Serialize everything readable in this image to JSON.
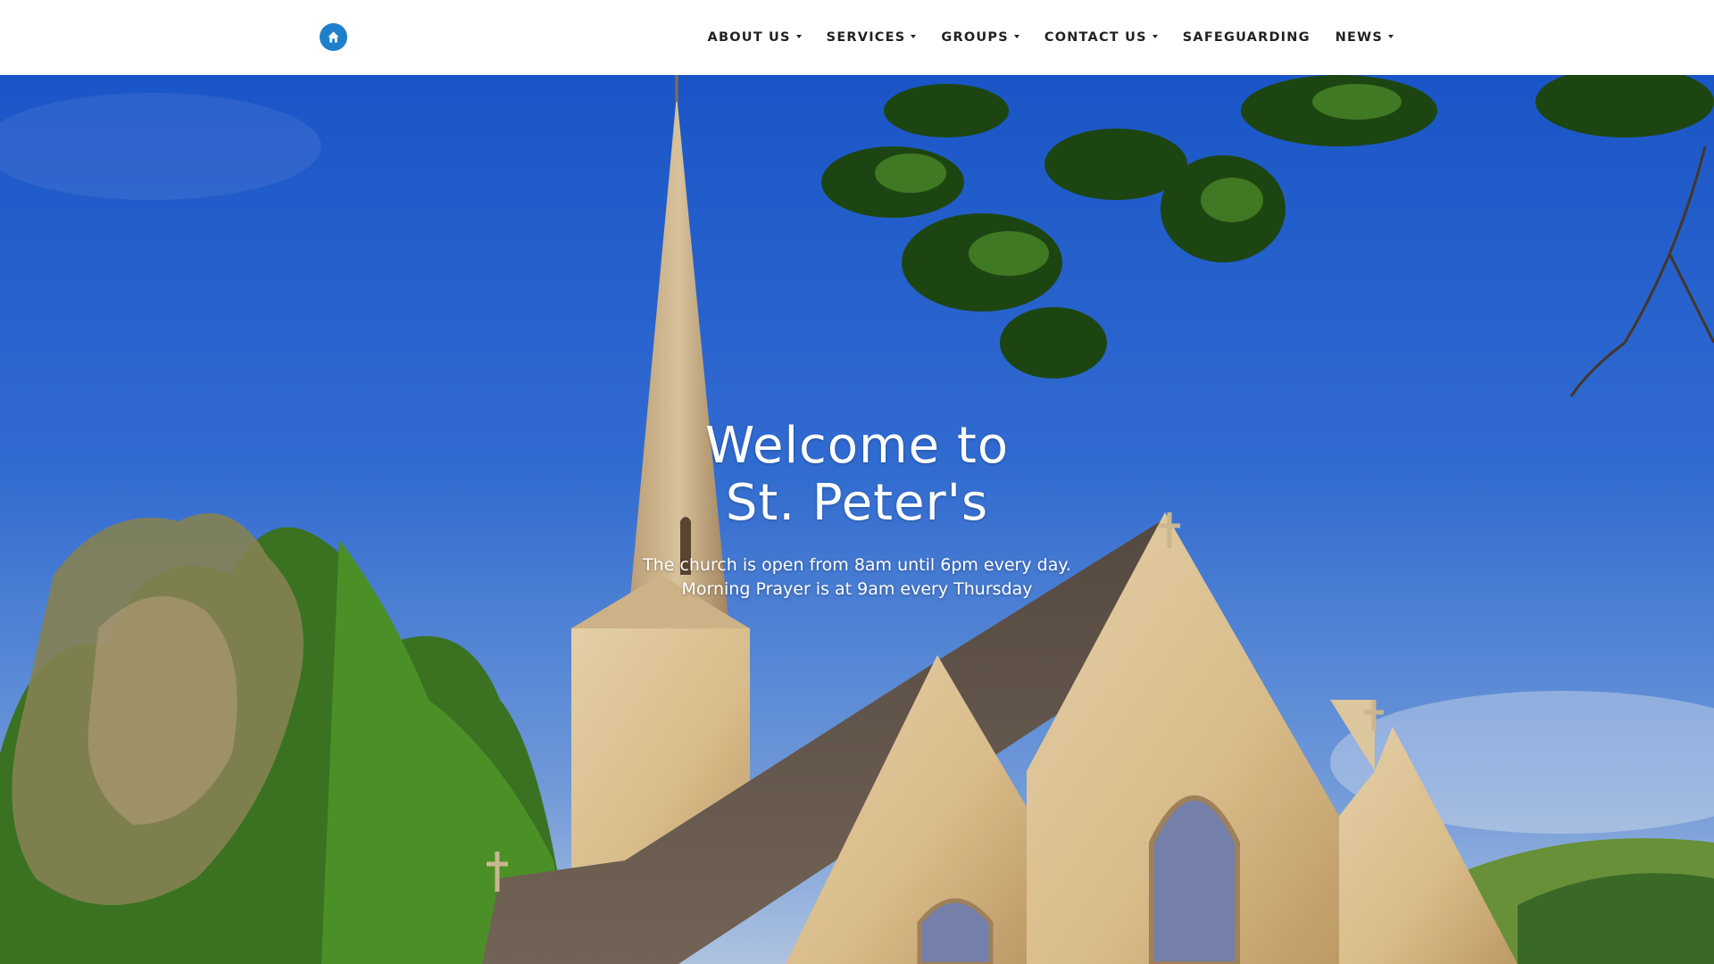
{
  "nav": {
    "logo_icon": "home-icon",
    "brand_color": "#1e7fcb",
    "items": [
      {
        "label": "ABOUT US",
        "has_dropdown": true
      },
      {
        "label": "SERVICES",
        "has_dropdown": true
      },
      {
        "label": "GROUPS",
        "has_dropdown": true
      },
      {
        "label": "CONTACT US",
        "has_dropdown": true
      },
      {
        "label": "SAFEGUARDING",
        "has_dropdown": false
      },
      {
        "label": "NEWS",
        "has_dropdown": true
      }
    ]
  },
  "hero": {
    "title_line1": "Welcome to",
    "title_line2": "St. Peter's",
    "subtitle_line1": "The church is open from 8am until 6pm every day.",
    "subtitle_line2": "Morning Prayer is at 9am every Thursday",
    "background": "church-photo"
  }
}
